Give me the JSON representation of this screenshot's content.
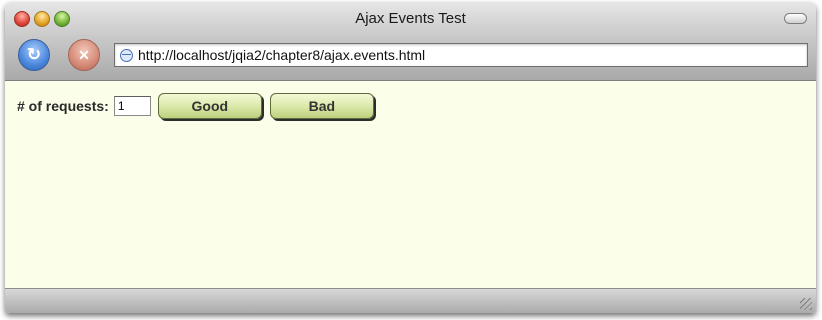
{
  "window": {
    "title": "Ajax Events Test"
  },
  "toolbar": {
    "reload_icon": "reload-icon",
    "stop_icon": "stop-icon",
    "url": "http://localhost/jqia2/chapter8/ajax.events.html"
  },
  "form": {
    "requests_label": "# of requests:",
    "requests_value": "1",
    "good_label": "Good",
    "bad_label": "Bad"
  },
  "colors": {
    "content_background": "#fbfee8",
    "button_fill": "#d8e7a6"
  }
}
